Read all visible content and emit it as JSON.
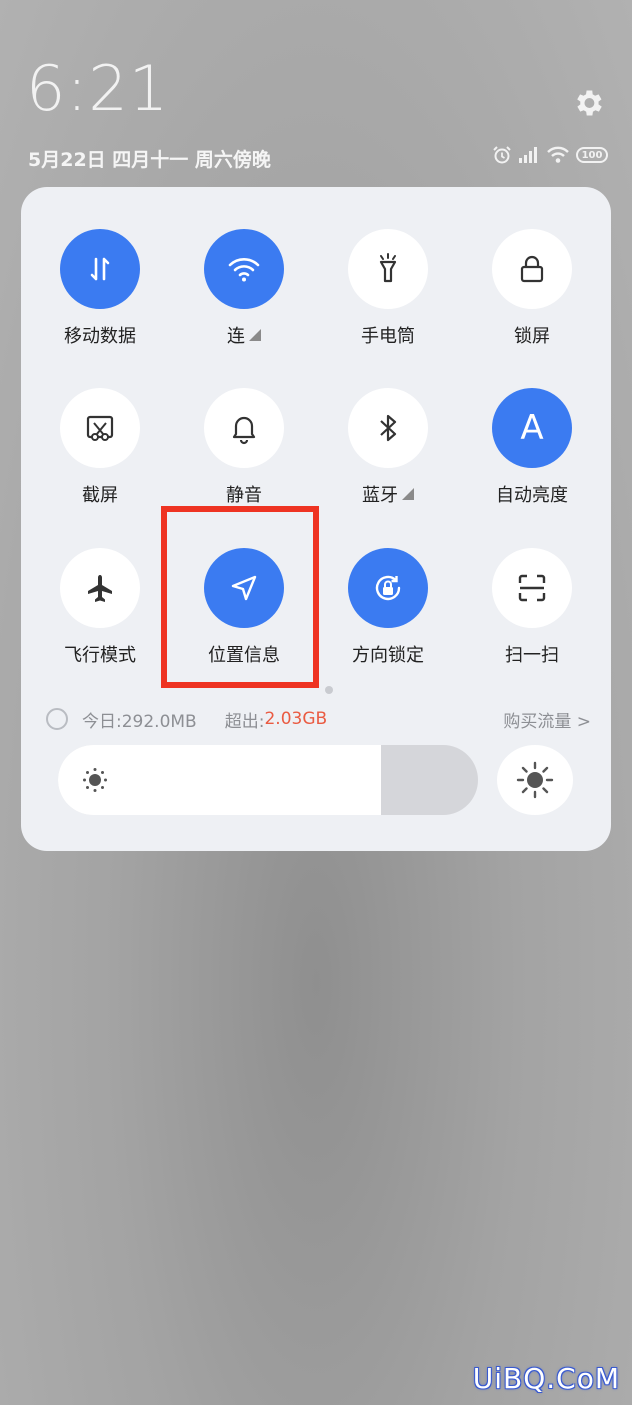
{
  "status": {
    "time": "6:21",
    "date": "5月22日 四月十一 周六傍晚",
    "battery": "100"
  },
  "tiles": [
    {
      "label": "移动数据",
      "icon": "mobile-data-icon",
      "on": true
    },
    {
      "label": "连",
      "icon": "wifi-icon",
      "on": true,
      "expand": true
    },
    {
      "label": "手电筒",
      "icon": "flashlight-icon",
      "on": false
    },
    {
      "label": "锁屏",
      "icon": "lock-icon",
      "on": false
    },
    {
      "label": "截屏",
      "icon": "screenshot-icon",
      "on": false
    },
    {
      "label": "静音",
      "icon": "bell-icon",
      "on": false
    },
    {
      "label": "蓝牙",
      "icon": "bluetooth-icon",
      "on": false,
      "expand": true
    },
    {
      "label": "自动亮度",
      "icon": "auto-brightness-icon",
      "on": true,
      "glyph": "A"
    },
    {
      "label": "飞行模式",
      "icon": "airplane-icon",
      "on": false
    },
    {
      "label": "位置信息",
      "icon": "location-icon",
      "on": true
    },
    {
      "label": "方向锁定",
      "icon": "rotation-lock-icon",
      "on": true
    },
    {
      "label": "扫一扫",
      "icon": "scan-icon",
      "on": false
    }
  ],
  "data_usage": {
    "today": "今日:292.0MB",
    "over_label": "超出:",
    "over_value": "2.03GB",
    "buy_link": "购买流量 >"
  },
  "brightness": {
    "level": 0.77
  },
  "colors": {
    "accent": "#3b7bf1",
    "highlight_box": "#ee3322",
    "over_value": "#ea5b42"
  },
  "watermark": "UiBQ.CoM"
}
